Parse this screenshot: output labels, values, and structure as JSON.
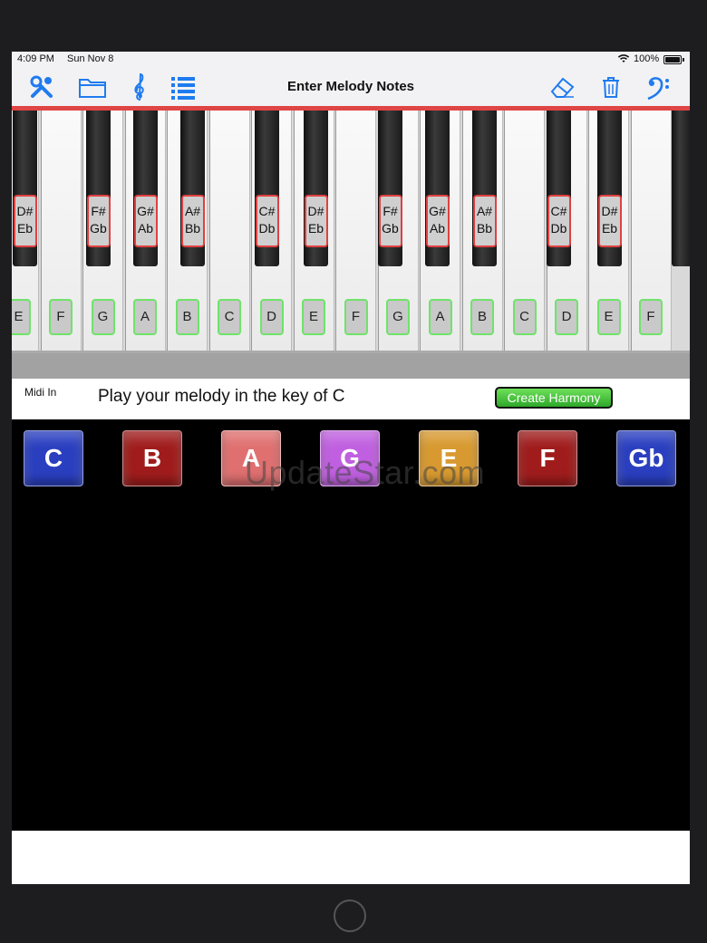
{
  "status_bar": {
    "time": "4:09 PM",
    "date": "Sun Nov 8",
    "battery": "100%"
  },
  "toolbar": {
    "title": "Enter Melody Notes",
    "left_icons": [
      "wrench-icon",
      "folder-icon",
      "treble-clef-icon",
      "list-icon"
    ],
    "right_icons": [
      "eraser-icon",
      "trash-icon",
      "bass-clef-icon"
    ]
  },
  "piano": {
    "white_keys": [
      "E",
      "F",
      "G",
      "A",
      "B",
      "C",
      "D",
      "E",
      "F",
      "G",
      "A",
      "B",
      "C",
      "D",
      "E",
      "F"
    ],
    "black_keys": [
      {
        "top": "D#",
        "bottom": "Eb"
      },
      {
        "top": "F#",
        "bottom": "Gb"
      },
      {
        "top": "G#",
        "bottom": "Ab"
      },
      {
        "top": "A#",
        "bottom": "Bb"
      },
      {
        "top": "C#",
        "bottom": "Db"
      },
      {
        "top": "D#",
        "bottom": "Eb"
      },
      {
        "top": "F#",
        "bottom": "Gb"
      },
      {
        "top": "G#",
        "bottom": "Ab"
      },
      {
        "top": "A#",
        "bottom": "Bb"
      },
      {
        "top": "C#",
        "bottom": "Db"
      },
      {
        "top": "D#",
        "bottom": "Eb"
      }
    ]
  },
  "info_bar": {
    "midi_label": "Midi In",
    "prompt": "Play your melody in the key of C",
    "harmony_button": "Create Harmony"
  },
  "chords": [
    {
      "label": "C",
      "color": "#2a3fc0"
    },
    {
      "label": "B",
      "color": "#a01c1c"
    },
    {
      "label": "A",
      "color": "#e07070"
    },
    {
      "label": "G",
      "color": "#c060e0"
    },
    {
      "label": "E",
      "color": "#d89a30"
    },
    {
      "label": "F",
      "color": "#a01c1c"
    },
    {
      "label": "Gb",
      "color": "#2a3fc0"
    }
  ],
  "watermark": "UpdateStar.com",
  "colors": {
    "accent": "#1e7bf0",
    "harmony_green": "#3dc43a",
    "black_key_border": "#e04040",
    "white_key_border": "#6fe36a"
  }
}
